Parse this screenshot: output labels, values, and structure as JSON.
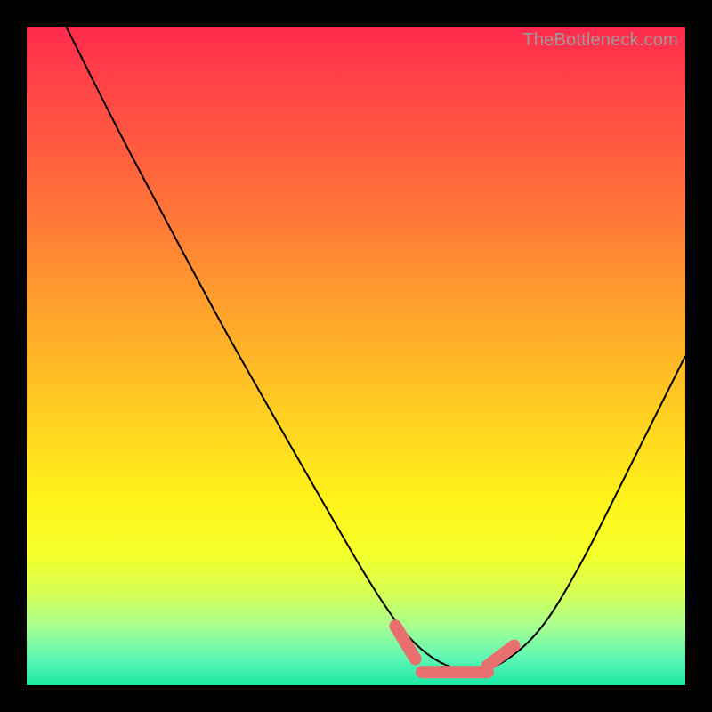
{
  "watermark": "TheBottleneck.com",
  "colors": {
    "highlight": "#e76f6f",
    "curve": "#000000",
    "frame": "#000000"
  },
  "chart_data": {
    "type": "line",
    "title": "",
    "xlabel": "",
    "ylabel": "",
    "xlim": [
      0,
      100
    ],
    "ylim": [
      0,
      100
    ],
    "grid": false,
    "legend": false,
    "series": [
      {
        "name": "bottleneck-curve",
        "x": [
          6,
          14,
          22,
          30,
          38,
          46,
          53,
          58,
          63,
          68,
          72,
          78,
          84,
          90,
          96,
          100
        ],
        "y": [
          100,
          84,
          69,
          54,
          40,
          26,
          14,
          7,
          3,
          2,
          3,
          8,
          18,
          30,
          42,
          50
        ]
      }
    ],
    "annotations": [
      {
        "name": "optimal-left-marker",
        "x_range": [
          56,
          59
        ],
        "y_range": [
          9,
          4
        ]
      },
      {
        "name": "optimal-flat-marker",
        "x_range": [
          60,
          70
        ],
        "y_range": [
          2,
          2
        ]
      },
      {
        "name": "optimal-right-marker",
        "x_range": [
          70,
          74
        ],
        "y_range": [
          3,
          6
        ]
      }
    ]
  }
}
